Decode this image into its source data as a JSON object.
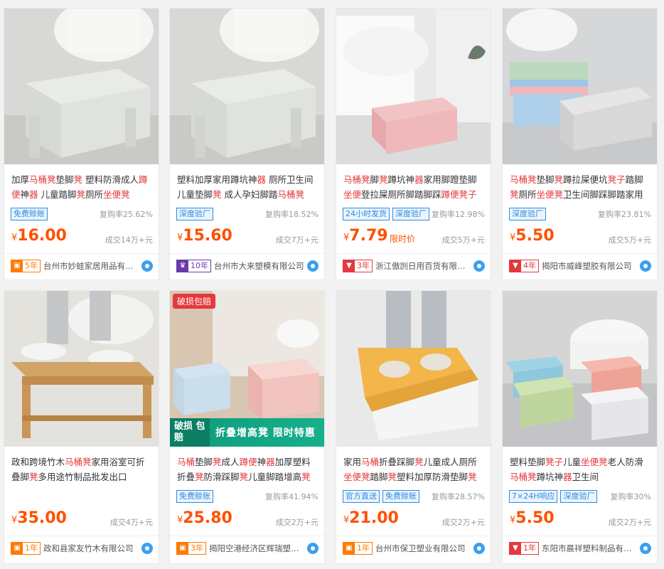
{
  "colors": {
    "price": "#ff5000",
    "highlight": "#e4393c",
    "tag": "#2f8be0",
    "background": "#f2f2f2"
  },
  "products": [
    {
      "title_parts": [
        [
          "加厚",
          0
        ],
        [
          "马桶凳",
          1
        ],
        [
          "垫脚",
          0
        ],
        [
          "凳",
          1
        ],
        [
          " 塑料防滑成人",
          0
        ],
        [
          "蹲便",
          1
        ],
        [
          "神",
          0
        ],
        [
          "器",
          1
        ],
        [
          " 儿童踏脚",
          0
        ],
        [
          "凳",
          1
        ],
        [
          "厕所",
          0
        ],
        [
          "坐便凳",
          1
        ]
      ],
      "tags": [
        "免费赊账"
      ],
      "repeat": "复购率25.62%",
      "price": "16.00",
      "promo": "",
      "sold": "成交14万+元",
      "shop_year": "5年",
      "shop_icon": "gift-icon",
      "shop_style": "orange",
      "shop": "台州市妙蛙家居用品有限公司"
    },
    {
      "title_parts": [
        [
          "塑料加厚家用蹲坑神",
          0
        ],
        [
          "器",
          1
        ],
        [
          " 厕所卫生间儿童垫脚",
          0
        ],
        [
          "凳",
          1
        ],
        [
          " 成人孕妇脚踏",
          0
        ],
        [
          "马桶凳",
          1
        ]
      ],
      "tags": [
        "深度验厂"
      ],
      "repeat": "复购率18.52%",
      "price": "15.60",
      "promo": "",
      "sold": "成交7万+元",
      "shop_year": "10年",
      "shop_icon": "crown-icon",
      "shop_style": "purple",
      "shop": "台州市大来塑模有限公司"
    },
    {
      "title_parts": [
        [
          "马桶凳",
          1
        ],
        [
          "脚",
          0
        ],
        [
          "凳",
          1
        ],
        [
          "蹲坑神",
          0
        ],
        [
          "器",
          1
        ],
        [
          "家用脚蹬垫脚",
          0
        ],
        [
          "坐便",
          1
        ],
        [
          "登拉屎厕所脚踏脚踩",
          0
        ],
        [
          "蹲便凳子",
          1
        ]
      ],
      "tags": [
        "24小时发货",
        "深度验厂"
      ],
      "repeat": "复购率12.98%",
      "price": "7.79",
      "promo": "限时价",
      "sold": "成交5万+元",
      "shop_year": "3年",
      "shop_icon": "medal-icon",
      "shop_style": "red",
      "shop": "浙江傲剀日用百货有限公司"
    },
    {
      "title_parts": [
        [
          "马桶凳",
          1
        ],
        [
          "垫脚",
          0
        ],
        [
          "凳",
          1
        ],
        [
          "蹲拉屎便坑",
          0
        ],
        [
          "凳子",
          1
        ],
        [
          "踏脚",
          0
        ],
        [
          "凳",
          1
        ],
        [
          "厕所",
          0
        ],
        [
          "坐便凳",
          1
        ],
        [
          "卫生间脚踩脚踏家用",
          0
        ]
      ],
      "tags": [
        "深度验厂"
      ],
      "repeat": "复购率23.81%",
      "price": "5.50",
      "promo": "",
      "sold": "成交5万+元",
      "shop_year": "4年",
      "shop_icon": "medal-icon",
      "shop_style": "red",
      "shop": "揭阳市威峰塑胶有限公司"
    },
    {
      "title_parts": [
        [
          "政和跨境竹木",
          0
        ],
        [
          "马桶凳",
          1
        ],
        [
          "家用浴室可折叠脚",
          0
        ],
        [
          "凳",
          1
        ],
        [
          "多用途竹制品批发出口",
          0
        ]
      ],
      "tags": [],
      "repeat": "",
      "price": "35.00",
      "promo": "",
      "sold": "成交4万+元",
      "shop_year": "1年",
      "shop_icon": "gift-icon",
      "shop_style": "orange",
      "shop": "政和县家友竹木有限公司"
    },
    {
      "title_parts": [
        [
          "马桶",
          1
        ],
        [
          "垫脚",
          0
        ],
        [
          "凳",
          1
        ],
        [
          "成人",
          0
        ],
        [
          "蹲便",
          1
        ],
        [
          "神",
          0
        ],
        [
          "器",
          1
        ],
        [
          "加厚塑料折叠",
          0
        ],
        [
          "凳",
          1
        ],
        [
          "防滑踩脚",
          0
        ],
        [
          "凳",
          1
        ],
        [
          "儿童脚踏增高",
          0
        ],
        [
          "凳",
          1
        ]
      ],
      "tags": [
        "免费赊账"
      ],
      "repeat": "复购率41.94%",
      "price": "25.80",
      "promo": "",
      "sold": "成交2万+元",
      "shop_year": "3年",
      "shop_icon": "gift-icon",
      "shop_style": "orange",
      "shop": "揭阳空港经济区辉瑞塑料制品厂",
      "ribbon": "破损包赔",
      "banner_left": "破损 包赔",
      "banner_right": "折叠增高凳  限时特惠"
    },
    {
      "title_parts": [
        [
          "家用",
          0
        ],
        [
          "马桶",
          1
        ],
        [
          "折叠踩脚",
          0
        ],
        [
          "凳",
          1
        ],
        [
          "儿童成人厕所",
          0
        ],
        [
          "坐便凳",
          1
        ],
        [
          "踏脚",
          0
        ],
        [
          "凳",
          1
        ],
        [
          "塑料加厚防滑垫脚",
          0
        ],
        [
          "凳",
          1
        ]
      ],
      "tags": [
        "官方直送",
        "免费赊账"
      ],
      "repeat": "复购率28.57%",
      "price": "21.00",
      "promo": "",
      "sold": "成交2万+元",
      "shop_year": "1年",
      "shop_icon": "gift-icon",
      "shop_style": "orange",
      "shop": "台州市保卫塑业有限公司"
    },
    {
      "title_parts": [
        [
          "塑料垫脚",
          0
        ],
        [
          "凳子",
          1
        ],
        [
          "儿童",
          0
        ],
        [
          "坐便凳",
          1
        ],
        [
          "老人防滑",
          0
        ],
        [
          "马桶凳",
          1
        ],
        [
          "蹲坑神",
          0
        ],
        [
          "器",
          1
        ],
        [
          "卫生间",
          0
        ]
      ],
      "tags": [
        "7×24H响应",
        "深度验厂"
      ],
      "repeat": "复购率30%",
      "price": "5.50",
      "promo": "",
      "sold": "成交2万+元",
      "shop_year": "1年",
      "shop_icon": "medal-icon",
      "shop_style": "red",
      "shop": "东阳市晨祥塑料制品有限公司"
    }
  ]
}
